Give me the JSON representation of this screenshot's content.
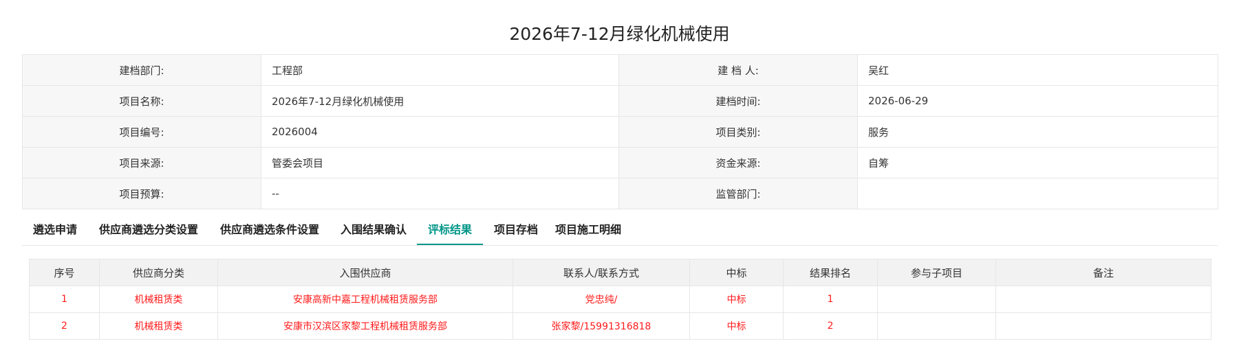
{
  "page_title": "2026年7-12月绿化机械使用",
  "info": [
    {
      "label1": "建档部门:",
      "value1": "工程部",
      "label2": "建 档 人:",
      "value2": "吴红"
    },
    {
      "label1": "项目名称:",
      "value1": "2026年7-12月绿化机械使用",
      "label2": "建档时间:",
      "value2": "2026-06-29"
    },
    {
      "label1": "项目编号:",
      "value1": "2026004",
      "label2": "项目类别:",
      "value2": "服务"
    },
    {
      "label1": "项目来源:",
      "value1": "管委会项目",
      "label2": "资金来源:",
      "value2": "自筹"
    },
    {
      "label1": "项目预算:",
      "value1": "--",
      "label2": "监管部门:",
      "value2": ""
    }
  ],
  "tabs": [
    {
      "label": "遴选申请"
    },
    {
      "label": "供应商遴选分类设置"
    },
    {
      "label": "供应商遴选条件设置"
    },
    {
      "label": "入围结果确认"
    },
    {
      "label": "评标结果"
    },
    {
      "label": "项目存档"
    },
    {
      "label": "项目施工明细"
    }
  ],
  "active_tab": "评标结果",
  "result_table": {
    "headers": [
      "序号",
      "供应商分类",
      "入围供应商",
      "联系人/联系方式",
      "中标",
      "结果排名",
      "参与子项目",
      "备注"
    ],
    "rows": [
      [
        "1",
        "机械租赁类",
        "安康高新中嘉工程机械租赁服务部",
        "党忠纯/",
        "中标",
        "1",
        "",
        ""
      ],
      [
        "2",
        "机械租赁类",
        "安康市汉滨区家黎工程机械租赁服务部",
        "张家黎/15991316818",
        "中标",
        "2",
        "",
        ""
      ]
    ]
  },
  "colors": {
    "accent": "#009688",
    "highlight_text": "#ff1a1a",
    "header_bg": "#f2f2f2",
    "label_bg": "#f7f7f7",
    "border": "#e6e6e6"
  }
}
